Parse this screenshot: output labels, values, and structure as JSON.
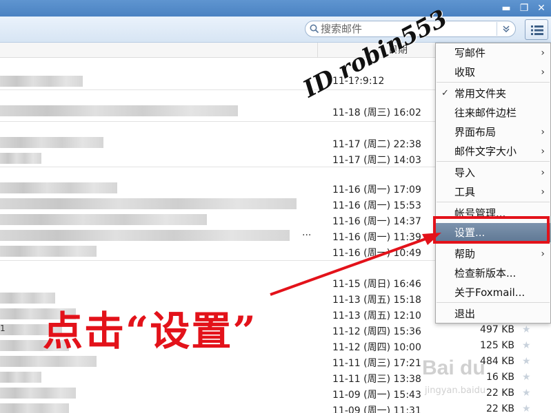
{
  "window": {
    "minimize": "▬",
    "restore": "❐",
    "close": "✕"
  },
  "toolbar": {
    "search_placeholder": "搜索邮件",
    "search_icon": "search-icon",
    "dropdown_icon": "double-chevron-down-icon",
    "menu_icon": "list-menu-icon"
  },
  "list": {
    "date_header": "日期",
    "left_marker": "1",
    "ellipsis": "...",
    "rows": [
      {
        "date": "11-1?:9:12",
        "size": ""
      },
      {
        "date": "11-18 (周三) 16:02",
        "size": ""
      },
      {
        "date": "11-17 (周二) 22:38",
        "size": ""
      },
      {
        "date": "11-17 (周二) 14:03",
        "size": ""
      },
      {
        "date": "11-16 (周一) 17:09",
        "size": ""
      },
      {
        "date": "11-16 (周一) 15:53",
        "size": ""
      },
      {
        "date": "11-16 (周一) 14:37",
        "size": ""
      },
      {
        "date": "11-16 (周一) 11:39",
        "size": ""
      },
      {
        "date": "11-16 (周一) 10:49",
        "size": ""
      },
      {
        "date": "11-15 (周日) 16:46",
        "size": ""
      },
      {
        "date": "11-13 (周五) 15:18",
        "size": ""
      },
      {
        "date": "11-13 (周五) 12:10",
        "size": ""
      },
      {
        "date": "11-12 (周四) 15:36",
        "size": "497 KB"
      },
      {
        "date": "11-12 (周四) 10:00",
        "size": "125 KB"
      },
      {
        "date": "11-11 (周三) 17:21",
        "size": "484 KB"
      },
      {
        "date": "11-11 (周三) 13:38",
        "size": "16 KB"
      },
      {
        "date": "11-09 (周一) 15:43",
        "size": "22 KB"
      },
      {
        "date": "11-09 (周一) 11:31",
        "size": "22 KB"
      }
    ]
  },
  "menu": {
    "items": [
      {
        "label": "写邮件",
        "arrow": "›"
      },
      {
        "label": "收取",
        "arrow": "›"
      },
      {
        "label": "常用文件夹",
        "check": "✓"
      },
      {
        "label": "往来邮件边栏"
      },
      {
        "label": "界面布局",
        "arrow": "›"
      },
      {
        "label": "邮件文字大小",
        "arrow": "›"
      },
      {
        "label": "导入",
        "arrow": "›"
      },
      {
        "label": "工具",
        "arrow": "›"
      },
      {
        "label": "帐号管理..."
      },
      {
        "label": "设置..."
      },
      {
        "label": "帮助",
        "arrow": "›"
      },
      {
        "label": "检查新版本..."
      },
      {
        "label": "关于Foxmail..."
      },
      {
        "label": "退出"
      }
    ]
  },
  "annotation": {
    "watermark": "ID robin553",
    "instruction": "点击“设置”",
    "accent_color": "#e3121a",
    "site_logo": "Bai du",
    "site_url": "jingyan.baidu"
  }
}
